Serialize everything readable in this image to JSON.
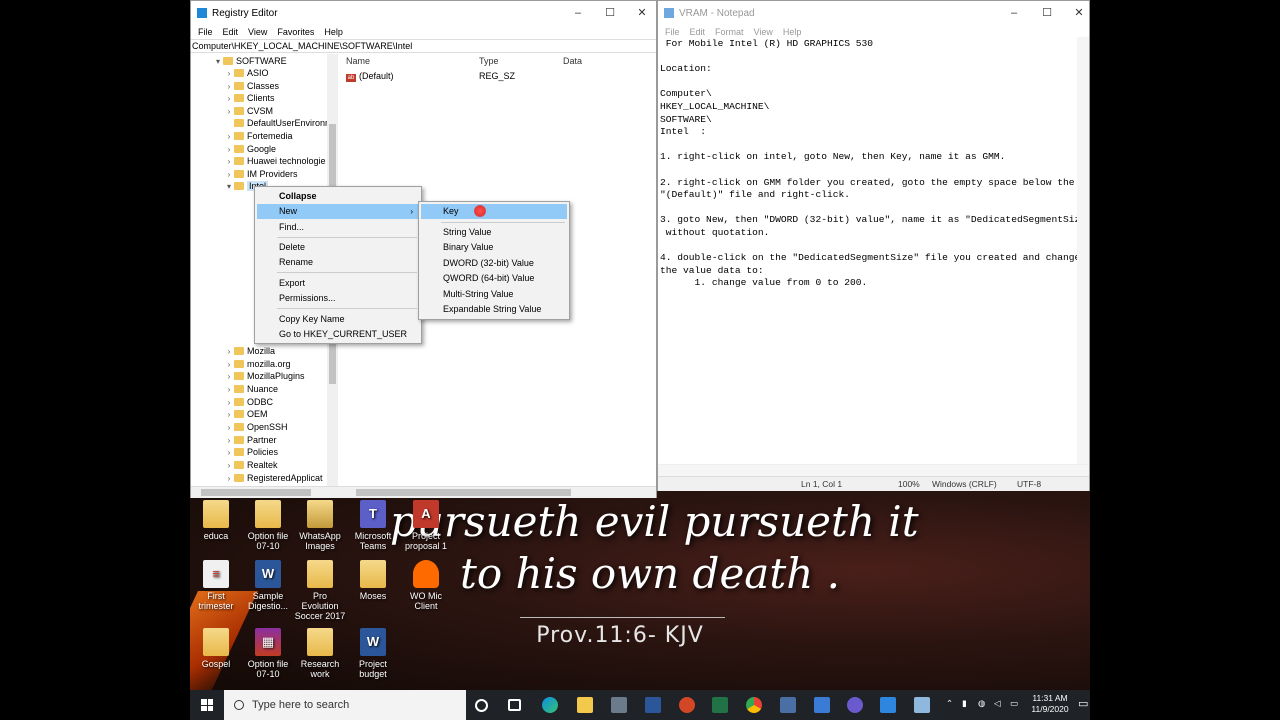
{
  "regedit": {
    "title": "Registry Editor",
    "window_buttons": [
      "–",
      "☐",
      "✕"
    ],
    "menu": [
      "File",
      "Edit",
      "View",
      "Favorites",
      "Help"
    ],
    "address": "Computer\\HKEY_LOCAL_MACHINE\\SOFTWARE\\Intel",
    "tree": [
      {
        "label": "SOFTWARE",
        "arrow": "▾"
      },
      {
        "label": "ASIO",
        "arrow": "›"
      },
      {
        "label": "Classes",
        "arrow": "›"
      },
      {
        "label": "Clients",
        "arrow": "›"
      },
      {
        "label": "CVSM",
        "arrow": "›"
      },
      {
        "label": "DefaultUserEnvironn",
        "arrow": ""
      },
      {
        "label": "Fortemedia",
        "arrow": "›"
      },
      {
        "label": "Google",
        "arrow": "›"
      },
      {
        "label": "Huawei technologie",
        "arrow": "›"
      },
      {
        "label": "IM Providers",
        "arrow": "›"
      },
      {
        "label": "Intel",
        "arrow": "▾"
      }
    ],
    "tree_lower": [
      {
        "label": "Mozilla",
        "arrow": "›"
      },
      {
        "label": "mozilla.org",
        "arrow": "›"
      },
      {
        "label": "MozillaPlugins",
        "arrow": "›"
      },
      {
        "label": "Nuance",
        "arrow": "›"
      },
      {
        "label": "ODBC",
        "arrow": "›"
      },
      {
        "label": "OEM",
        "arrow": "›"
      },
      {
        "label": "OpenSSH",
        "arrow": "›"
      },
      {
        "label": "Partner",
        "arrow": "›"
      },
      {
        "label": "Policies",
        "arrow": "›"
      },
      {
        "label": "Realtek",
        "arrow": "›"
      },
      {
        "label": "RegisteredApplicat",
        "arrow": "›"
      }
    ],
    "columns": {
      "name": "Name",
      "type": "Type",
      "data": "Data"
    },
    "rows": [
      {
        "name": "(Default)",
        "type": "REG_SZ",
        "data": ""
      }
    ]
  },
  "context_menu": {
    "items": [
      "Collapse",
      "New",
      "Find...",
      "Delete",
      "Rename",
      "Export",
      "Permissions...",
      "Copy Key Name",
      "Go to HKEY_CURRENT_USER"
    ]
  },
  "new_submenu": {
    "items": [
      "Key",
      "String Value",
      "Binary Value",
      "DWORD (32-bit) Value",
      "QWORD (64-bit) Value",
      "Multi-String Value",
      "Expandable String Value"
    ]
  },
  "notepad": {
    "title": "VRAM - Notepad",
    "window_buttons": [
      "–",
      "☐",
      "✕"
    ],
    "menu": [
      "File",
      "Edit",
      "Format",
      "View",
      "Help"
    ],
    "text": " For Mobile Intel (R) HD GRAPHICS 530\n\nLocation:\n\nComputer\\\nHKEY_LOCAL_MACHINE\\\nSOFTWARE\\\nIntel  :\n\n1. right-click on intel, goto New, then Key, name it as GMM.\n\n2. right-click on GMM folder you created, goto the empty space below the\n\"(Default)\" file and right-click.\n\n3. goto New, then \"DWORD (32-bit) value\", name it as \"DedicatedSegmentSize\"\n without quotation.\n\n4. double-click on the \"DedicatedSegmentSize\" file you created and change\nthe value data to:\n      1. change value from 0 to 200.",
    "status": {
      "position": "Ln 1, Col 1",
      "zoom": "100%",
      "line_endings": "Windows (CRLF)",
      "encoding": "UTF-8"
    }
  },
  "desktop": {
    "icons": [
      {
        "label": "educa",
        "kind": "folder"
      },
      {
        "label": "Option file 07-10",
        "kind": "folder"
      },
      {
        "label": "WhatsApp Images",
        "kind": "whats"
      },
      {
        "label": "Microsoft Teams",
        "kind": "teams"
      },
      {
        "label": "Project proposal 1",
        "kind": "pdf"
      },
      {
        "label": "First trimester",
        "kind": "ftext"
      },
      {
        "label": "Sample Digestio...",
        "kind": "word"
      },
      {
        "label": "Pro Evolution Soccer 2017",
        "kind": "folder"
      },
      {
        "label": "Moses",
        "kind": "folder"
      },
      {
        "label": "WO Mic Client",
        "kind": "mic"
      },
      {
        "label": "Gospel",
        "kind": "folder"
      },
      {
        "label": "Option file 07-10",
        "kind": "archive"
      },
      {
        "label": "Research work",
        "kind": "folder"
      },
      {
        "label": "Project budget",
        "kind": "word"
      }
    ],
    "wallpaper_verse": "pursueth evil pursueth it\nto his own death .",
    "wallpaper_ref": "Prov.11:6- KJV"
  },
  "taskbar": {
    "search_placeholder": "Type here to search",
    "time": "11:31 AM",
    "date": "11/9/2020"
  }
}
